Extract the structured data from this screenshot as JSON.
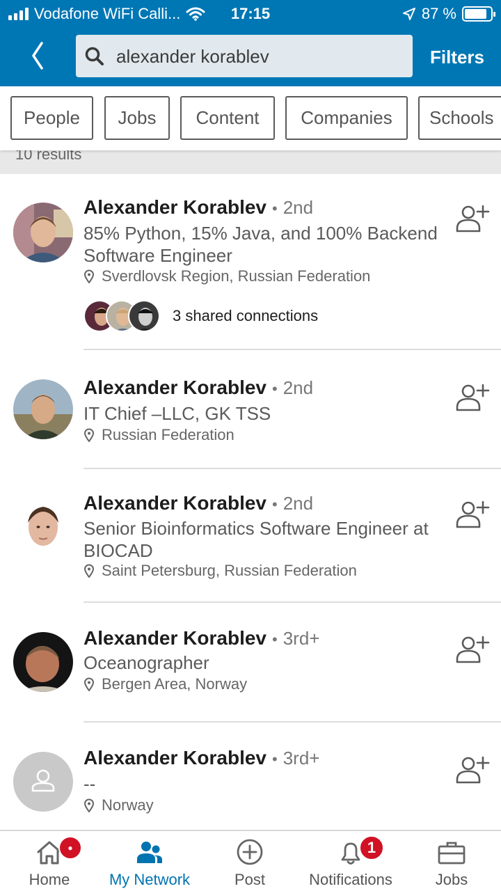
{
  "status_bar": {
    "carrier": "Vodafone WiFi Calli...",
    "time": "17:15",
    "battery": "87 %",
    "battery_level": 0.87
  },
  "search": {
    "query": "alexander korablev",
    "filters_label": "Filters"
  },
  "chips": [
    {
      "label": "People"
    },
    {
      "label": "Jobs"
    },
    {
      "label": "Content"
    },
    {
      "label": "Companies"
    },
    {
      "label": "Schools"
    }
  ],
  "results_count": "10 results",
  "results": [
    {
      "name": "Alexander Korablev",
      "degree": "2nd",
      "headline": "85% Python, 15% Java, and 100% Backend Software Engineer",
      "location": "Sverdlovsk Region, Russian Federation",
      "shared": "3 shared connections"
    },
    {
      "name": "Alexander Korablev",
      "degree": "2nd",
      "headline": "IT Chief –LLC, GK TSS",
      "location": "Russian Federation"
    },
    {
      "name": "Alexander Korablev",
      "degree": "2nd",
      "headline": "Senior Bioinformatics Software Engineer at BIOCAD",
      "location": "Saint Petersburg, Russian Federation"
    },
    {
      "name": "Alexander Korablev",
      "degree": "3rd+",
      "headline": "Oceanographer",
      "location": "Bergen Area, Norway"
    },
    {
      "name": "Alexander Korablev",
      "degree": "3rd+",
      "headline": "--",
      "location": "Norway"
    }
  ],
  "tabs": [
    {
      "label": "Home",
      "icon": "home-icon"
    },
    {
      "label": "My Network",
      "icon": "network-icon"
    },
    {
      "label": "Post",
      "icon": "post-icon"
    },
    {
      "label": "Notifications",
      "icon": "bell-icon",
      "badge": "1"
    },
    {
      "label": "Jobs",
      "icon": "briefcase-icon"
    }
  ],
  "colors": {
    "brand_blue": "#0077b5",
    "badge_red": "#d11124"
  }
}
